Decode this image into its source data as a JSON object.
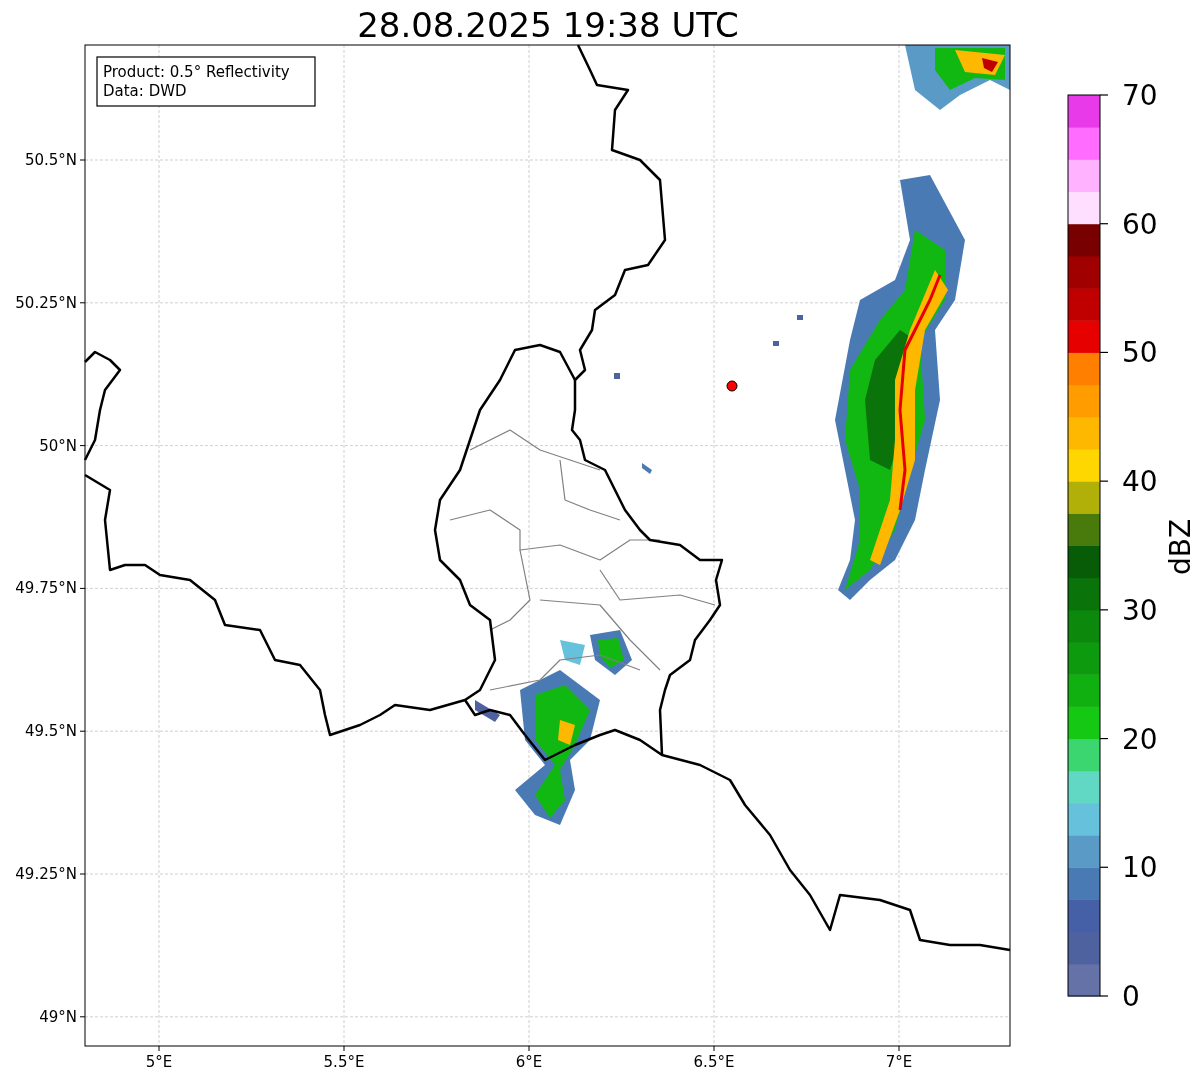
{
  "title": "28.08.2025 19:38 UTC",
  "info_box": [
    "Product: 0.5° Reflectivity",
    "Data: DWD"
  ],
  "map": {
    "x_tick_labels": [
      "5°E",
      "5.5°E",
      "6°E",
      "6.5°E",
      "7°E"
    ],
    "y_tick_labels": [
      "50.5°N",
      "50.25°N",
      "50°N",
      "49.75°N",
      "49.5°N",
      "49.25°N",
      "49°N"
    ]
  },
  "colorbar": {
    "label": "dBZ",
    "tick_labels": [
      "70",
      "60",
      "50",
      "40",
      "30",
      "20",
      "10",
      "0"
    ],
    "bands": [
      {
        "color": "#6472a8"
      },
      {
        "color": "#4f62a0"
      },
      {
        "color": "#4560a6"
      },
      {
        "color": "#4a7ab4"
      },
      {
        "color": "#5a9ac6"
      },
      {
        "color": "#66c2dc"
      },
      {
        "color": "#60d8c4"
      },
      {
        "color": "#3cd670"
      },
      {
        "color": "#14c814"
      },
      {
        "color": "#10b010"
      },
      {
        "color": "#0e9a0e"
      },
      {
        "color": "#0c880c"
      },
      {
        "color": "#0a740a"
      },
      {
        "color": "#085c08"
      },
      {
        "color": "#487a0c"
      },
      {
        "color": "#b0b008"
      },
      {
        "color": "#ffd700"
      },
      {
        "color": "#ffb800"
      },
      {
        "color": "#ff9c00"
      },
      {
        "color": "#ff7f00"
      },
      {
        "color": "#e60000"
      },
      {
        "color": "#c00000"
      },
      {
        "color": "#a00000"
      },
      {
        "color": "#780000"
      },
      {
        "color": "#ffdfff"
      },
      {
        "color": "#ffb2ff"
      },
      {
        "color": "#ff6cff"
      },
      {
        "color": "#e83ae8"
      }
    ]
  }
}
